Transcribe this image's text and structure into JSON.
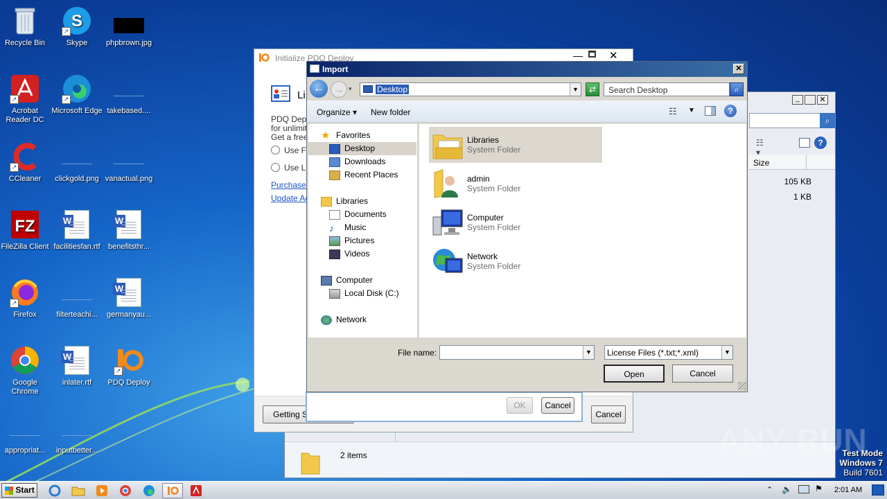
{
  "desktop": {
    "icons": [
      {
        "label": "Recycle Bin"
      },
      {
        "label": "Skype"
      },
      {
        "label": "phpbrown.jpg"
      },
      {
        "label": "Acrobat Reader DC"
      },
      {
        "label": "Microsoft Edge"
      },
      {
        "label": "takebased...."
      },
      {
        "label": "CCleaner"
      },
      {
        "label": "clickgold.png"
      },
      {
        "label": "vanactual.png"
      },
      {
        "label": "FileZilla Client"
      },
      {
        "label": "facilitiesfan.rtf"
      },
      {
        "label": "benefitsthr..."
      },
      {
        "label": "Firefox"
      },
      {
        "label": "filterteachi..."
      },
      {
        "label": "germanyau..."
      },
      {
        "label": "Google Chrome"
      },
      {
        "label": "inlater.rtf"
      },
      {
        "label": "PDQ Deploy"
      },
      {
        "label": "appropriat..."
      },
      {
        "label": "inputbetter..."
      }
    ]
  },
  "bg_window": {
    "title": "Initialize PDQ Deploy",
    "heading": "Li",
    "text1": "PDQ Deplo",
    "text2": "for unlimit",
    "text3": "Get a free",
    "radio1": "Use Fr",
    "radio2": "Use Li",
    "link1": "Purchase l",
    "link2": "Update Ac",
    "getting_started": "Getting St",
    "cancel": "Cancel",
    "inner_ok": "OK",
    "inner_cancel": "Cancel"
  },
  "explorer_bg": {
    "col_size": "Size",
    "sizes": [
      "105 KB",
      "1 KB"
    ],
    "item_count": "2 items"
  },
  "dialog": {
    "title": "Import",
    "address": "Desktop",
    "search_placeholder": "Search Desktop",
    "organize": "Organize",
    "new_folder": "New folder",
    "nav": {
      "favorites": "Favorites",
      "desktop": "Desktop",
      "downloads": "Downloads",
      "recent": "Recent Places",
      "libraries": "Libraries",
      "documents": "Documents",
      "music": "Music",
      "pictures": "Pictures",
      "videos": "Videos",
      "computer": "Computer",
      "local_disk": "Local Disk (C:)",
      "network": "Network"
    },
    "items": [
      {
        "name": "Libraries",
        "type": "System Folder"
      },
      {
        "name": "admin",
        "type": "System Folder"
      },
      {
        "name": "Computer",
        "type": "System Folder"
      },
      {
        "name": "Network",
        "type": "System Folder"
      }
    ],
    "file_name_label": "File name:",
    "file_name_value": "",
    "file_type": "License Files (*.txt;*.xml)",
    "open": "Open",
    "cancel": "Cancel"
  },
  "watermark": {
    "brand": "ANY RUN",
    "line1": "Test Mode",
    "line2": "Windows 7",
    "line3": "Build 7601"
  },
  "taskbar": {
    "start": "Start",
    "clock": "2:01 AM"
  }
}
